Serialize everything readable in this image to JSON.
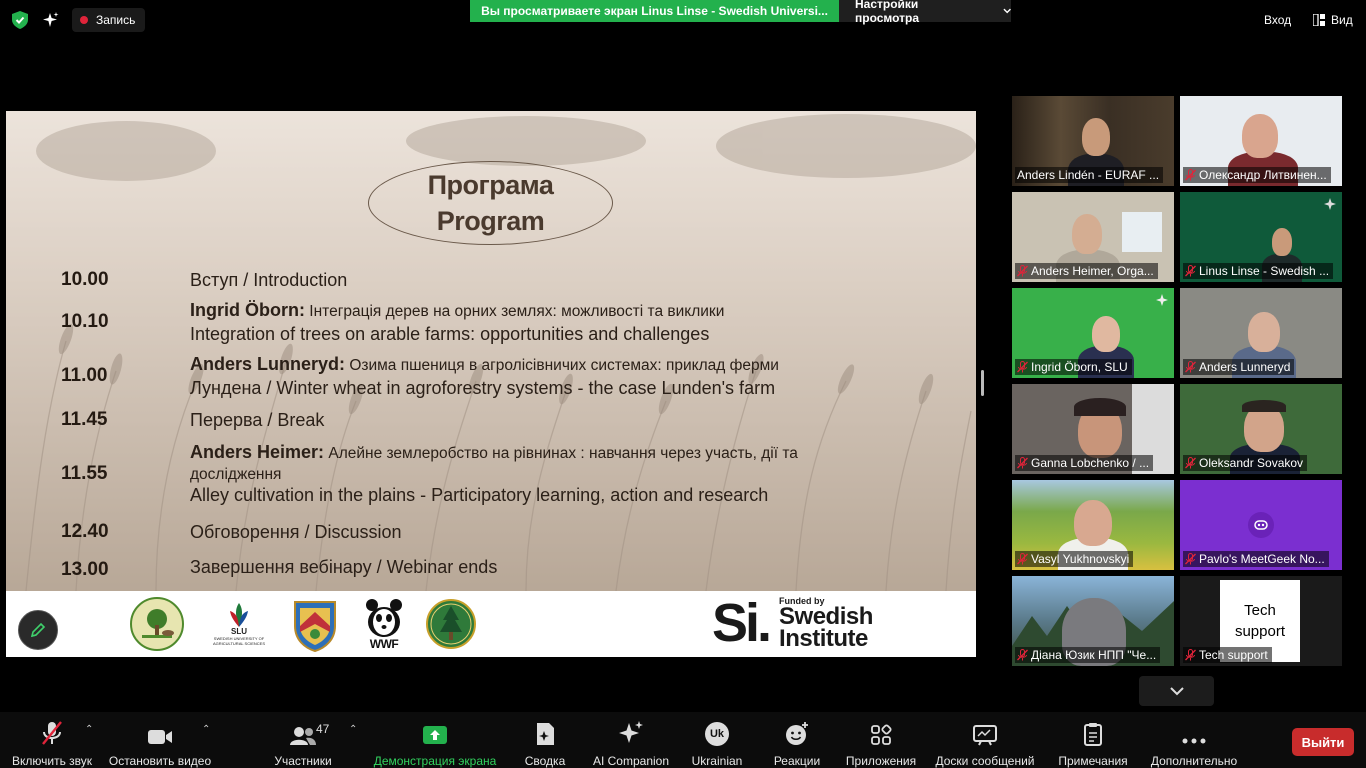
{
  "topbar": {
    "recording_label": "Запись",
    "share_banner": "Вы просматриваете экран Linus Linse - Swedish Universi...",
    "view_options": "Настройки просмотра",
    "enter_label": "Вход",
    "view_label": "Вид"
  },
  "slide": {
    "title_uk": "Програма",
    "title_en": "Program",
    "items": [
      {
        "time": "10.00",
        "line1": "Вступ / Introduction"
      },
      {
        "time": "10.10",
        "speaker": "Ingrid Öborn:",
        "line1": " Інтеграція дерев на орних землях: можливості та виклики",
        "line2": "Integration of trees on arable farms: opportunities and challenges"
      },
      {
        "time": "11.00",
        "speaker": "Anders Lunneryd:",
        "line1": " Озима пшениця в агролісівничих системах: приклад ферми",
        "line2": "Лундена / Winter wheat in agroforestry systems - the case Lunden's farm"
      },
      {
        "time": "11.45",
        "line1": "Перерва / Break"
      },
      {
        "time": "11.55",
        "speaker": "Anders Heimer:",
        "line1": " Алейне землеробство на рівнинах : навчання через участь, дії та",
        "line1b": "дослідження",
        "line2": "Alley cultivation in the plains - Participatory learning, action and research"
      },
      {
        "time": "12.40",
        "line1": "Обговорення / Discussion"
      },
      {
        "time": "13.00",
        "line1": "Завершення вебінару / Webinar ends"
      }
    ],
    "logos": {
      "agroforestry_sweden": "AGROFORESTRY SWEDEN",
      "slu": "SLU",
      "slu_sub": "SWEDISH UNIVERSITY OF AGRICULTURAL SCIENCES",
      "wwf": "WWF",
      "si_mark": "Si.",
      "si_funded": "Funded by",
      "si_name1": "Swedish",
      "si_name2": "Institute"
    }
  },
  "participants": [
    {
      "name": "Anders Lindén - EURAF ...",
      "muted": false,
      "active": true
    },
    {
      "name": "Олександр Литвинен...",
      "muted": true
    },
    {
      "name": "Anders Heimer, Orga...",
      "muted": true
    },
    {
      "name": "Linus Linse - Swedish ...",
      "muted": true
    },
    {
      "name": "Ingrid Öborn, SLU",
      "muted": true
    },
    {
      "name": "Anders Lunneryd",
      "muted": true
    },
    {
      "name": "Ganna Lobchenko / ...",
      "muted": true
    },
    {
      "name": "Oleksandr Sovakov",
      "muted": true
    },
    {
      "name": "Vasyl Yukhnovskyi",
      "muted": true
    },
    {
      "name": "Pavlo's MeetGeek No...",
      "muted": true
    },
    {
      "name": "Діана Юзик НПП \"Че...",
      "muted": true
    },
    {
      "name": "Tech support",
      "muted": true,
      "card_line1": "Tech",
      "card_line2": "support"
    }
  ],
  "toolbar": {
    "unmute": "Включить звук",
    "stop_video": "Остановить видео",
    "participants": "Участники",
    "participants_count": "47",
    "share_screen": "Демонстрация экрана",
    "summary": "Сводка",
    "ai_companion": "AI Companion",
    "language": "Ukrainian",
    "language_badge": "Uk",
    "reactions": "Реакции",
    "apps": "Приложения",
    "whiteboards": "Доски сообщений",
    "notes": "Примечания",
    "more": "Дополнительно",
    "leave": "Выйти"
  },
  "colors": {
    "share_green": "#23b14d",
    "leave_red": "#c82c2c",
    "active_speaker": "#e6e86d",
    "muted_red": "#e0243a"
  }
}
